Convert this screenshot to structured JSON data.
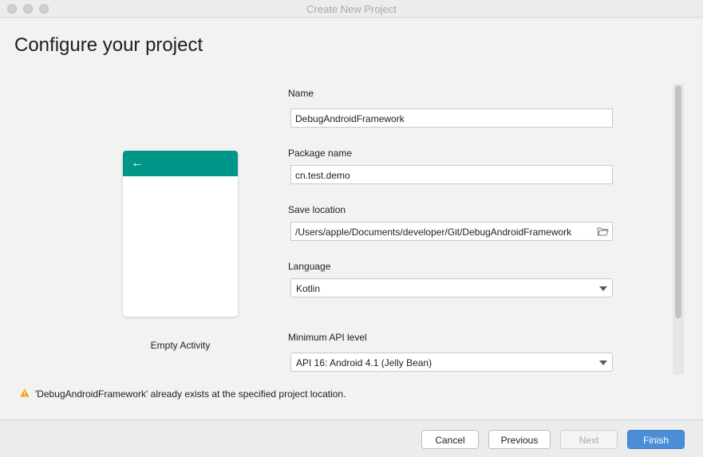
{
  "window": {
    "title": "Create New Project"
  },
  "page": {
    "heading": "Configure your project"
  },
  "preview": {
    "label": "Empty Activity",
    "back_glyph": "←",
    "accent": "#009688"
  },
  "form": {
    "name": {
      "label": "Name",
      "value": "DebugAndroidFramework"
    },
    "package": {
      "label": "Package name",
      "value": "cn.test.demo"
    },
    "location": {
      "label": "Save location",
      "value": "/Users/apple/Documents/developer/Git/DebugAndroidFramework",
      "icon": "folder-icon"
    },
    "language": {
      "label": "Language",
      "value": "Kotlin"
    },
    "min_api": {
      "label": "Minimum API level",
      "value": "API 16: Android 4.1 (Jelly Bean)"
    }
  },
  "warning": {
    "text": "'DebugAndroidFramework' already exists at the specified project location.",
    "icon": "warning-icon",
    "color": "#f0a30a"
  },
  "buttons": {
    "cancel": "Cancel",
    "previous": "Previous",
    "next": "Next",
    "finish": "Finish",
    "primary_color": "#4a8fd6"
  }
}
